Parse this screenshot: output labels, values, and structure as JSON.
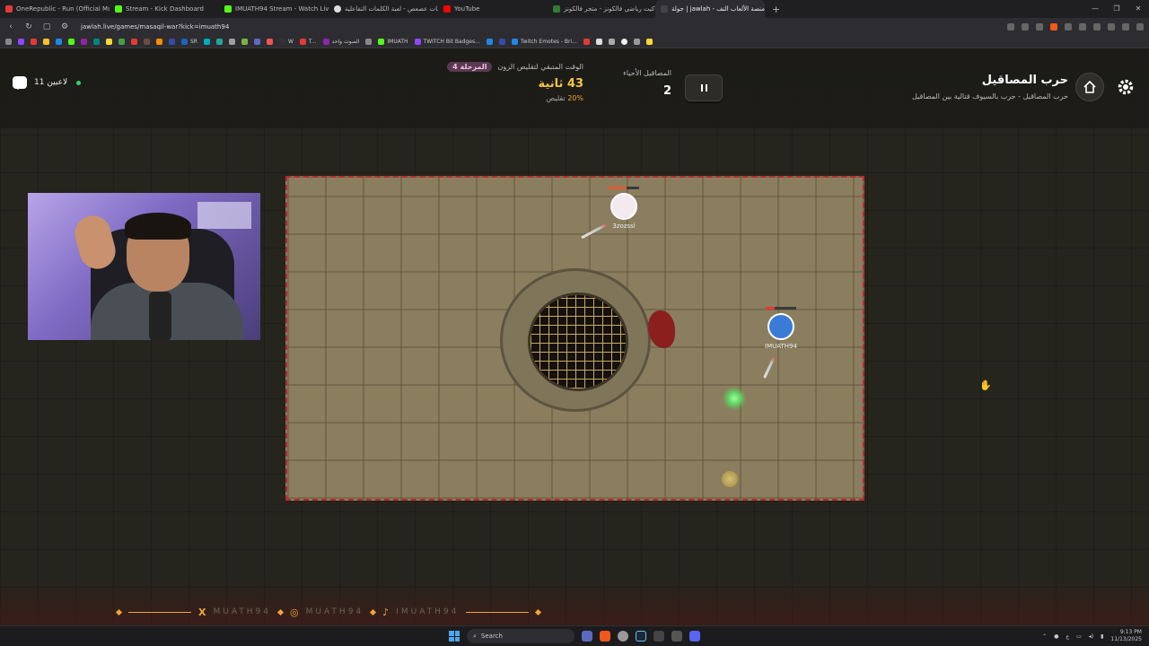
{
  "browser": {
    "tabs": [
      {
        "title": "OneRepublic - Run (Official Music",
        "color": "#e53935",
        "active": false
      },
      {
        "title": "Stream - Kick Dashboard",
        "color": "#53fc18",
        "active": false
      },
      {
        "title": "IMUATH94 Stream - Watch Live on",
        "color": "#53fc18",
        "active": false
      },
      {
        "title": "كلمات عصعص - لعبة الكلمات التفاعلية",
        "color": "#dddddd",
        "active": false
      },
      {
        "title": "YouTube",
        "color": "#ff0000",
        "active": false
      },
      {
        "title": "جاكيت رياضي فالكونز - متجر فالكونز",
        "color": "#2e7d32",
        "active": false
      },
      {
        "title": "جولة | jawlah - منصة الألعاب التف",
        "color": "#444444",
        "active": true
      }
    ],
    "new_tab": "+",
    "url": "jawlah.live/games/masaqil-war?kick=imuath94",
    "bookmarks": [
      {
        "label": "SR",
        "color": "#1565c0"
      },
      {
        "label": "W",
        "color": "#333333"
      },
      {
        "label": "T...",
        "color": "#e53935"
      },
      {
        "label": "الصوت واحد",
        "color": "#8e24aa"
      },
      {
        "label": "IMUATH",
        "color": "#53fc18"
      },
      {
        "label": "TWITCH Bit Badges...",
        "color": "#9146ff"
      },
      {
        "label": "Twitch Emotes - Bri...",
        "color": "#1e88e5"
      }
    ]
  },
  "game": {
    "players_online": "11 لاعبين",
    "timer": {
      "label": "الوقت المتبقي لتقليص الزون",
      "stage": "المرحلة 4",
      "value": "43 ثانية",
      "shrink_percent": "20%",
      "shrink_label": "تقليص"
    },
    "alive": {
      "label": "المصاقيل الأحياء",
      "count": "2"
    },
    "title": "حرب المصاقيل",
    "subtitle": "حرب المصاقيل - حرب بالسيوف قتالية بين المصاقيل",
    "players": [
      {
        "name": "3zozssl",
        "hp_color": "#e05a2a",
        "avatar_color": "#f3e9ee"
      },
      {
        "name": "IMUATH94",
        "hp_color": "#e53935",
        "avatar_color": "#3a7bd5"
      }
    ]
  },
  "footer": {
    "handle_1": "MUATH94",
    "handle_2": "MUATH94",
    "handle_3": "IMUATH94"
  },
  "taskbar": {
    "search_placeholder": "Search",
    "time": "9:13 PM",
    "date": "11/13/2025",
    "lang": "ع"
  }
}
